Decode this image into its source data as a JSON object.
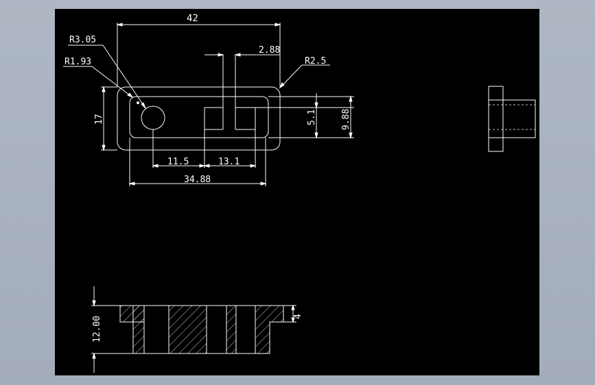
{
  "colors": {
    "background": "#000000",
    "line": "#ffffff",
    "frame": "#a9b2bf"
  },
  "dimensions": {
    "overall_width": "42",
    "radius_large": "R3.05",
    "radius_small": "R1.93",
    "slot_width": "2.88",
    "corner_radius": "R2.5",
    "height": "17",
    "slot_depth": "5.1",
    "slot_height": "9.88",
    "hole_offset": "11.5",
    "slot_offset": "13.1",
    "inner_width": "34.88",
    "front_height": "12.00",
    "flange_thickness": "4"
  }
}
